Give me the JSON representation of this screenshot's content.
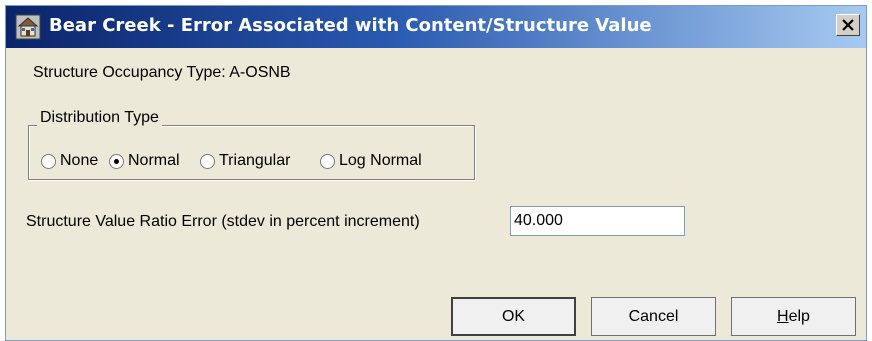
{
  "window": {
    "title": "Bear Creek - Error Associated with Content/Structure Value",
    "icon": "app-building-icon",
    "close_icon": "close-icon"
  },
  "occupancy": {
    "text": "Structure Occupancy Type:  A-OSNB"
  },
  "distribution": {
    "legend": "Distribution Type",
    "options": [
      {
        "label": "None",
        "checked": false
      },
      {
        "label": "Normal",
        "checked": true
      },
      {
        "label": "Triangular",
        "checked": false
      },
      {
        "label": "Log Normal",
        "checked": false
      }
    ]
  },
  "ratio_error": {
    "label": "Structure Value Ratio Error (stdev in percent increment)",
    "value": "40.000"
  },
  "buttons": {
    "ok": "OK",
    "cancel": "Cancel",
    "help_prefix": "H",
    "help_rest": "elp"
  }
}
